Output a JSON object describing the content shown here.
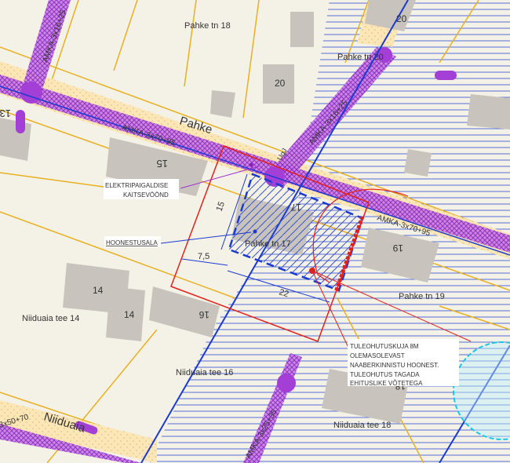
{
  "map": {
    "streets": {
      "pahke": "Pahke",
      "niiduaia": "Niiduaia"
    },
    "addresses": {
      "pahke_18": "Pahke tn 18",
      "pahke_20": "Pahke tn 20",
      "pahke_17": "Pahke tn 17",
      "pahke_19": "Pahke tn 19",
      "niiduaia_14": "Niiduaia tee 14",
      "niiduaia_16": "Niiduaia tee 16",
      "niiduaia_18": "Niiduaia tee 18"
    },
    "house_numbers": {
      "n20_top": "20",
      "n20": "20",
      "n13": "13",
      "n15": "15",
      "n17": "17",
      "n19": "19",
      "n14": "14",
      "n14b": "14",
      "n16": "16",
      "n18": "18",
      "n24": "24"
    },
    "cables": {
      "amka_3x16_top": "AMKA-3x16+25",
      "amka_3x70_left": "AMKA-3x70+95",
      "amka_3x16_mid": "AMKA-3x16+25",
      "amka_3x70_right": "AMKA-3x70+95",
      "amka_3x50": "3x50+70",
      "amka_3x25": "AMKA-3x25+35",
      "amka_small": "UgJ"
    },
    "dimensions": {
      "d15": "15",
      "d75": "7,5",
      "d22": "22"
    },
    "callouts": {
      "elektri_line1": "ELEKTRIPAIGALDISE",
      "elektri_line2": "KAITSEVÖÖND",
      "hoonestusala": "HOONESTUSALA",
      "fire_line1": "TULEOHUTUSKUJA 8M",
      "fire_line2": "OLEMASOLEVAST",
      "fire_line3": "NAABERKINNISTU HOONEST.",
      "fire_line4": "TULEOHUTUS TAGADA",
      "fire_line5": "EHITUSLIKE VÕTETEGA"
    },
    "colors": {
      "background": "#f4f2e6",
      "road_fill": "#fbe3b0",
      "parcel_line": "#f0b000",
      "building": "#c9c5c0",
      "cable": "#9b30d0",
      "hatch_blue": "#2244cc",
      "red": "#e3201b",
      "cyan": "#19c6e6"
    }
  }
}
